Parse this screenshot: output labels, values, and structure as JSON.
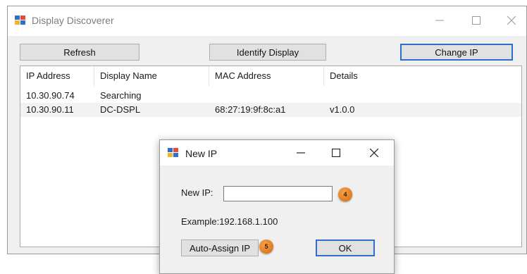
{
  "window": {
    "title": "Display Discoverer"
  },
  "toolbar": {
    "refresh_label": "Refresh",
    "identify_label": "Identify Display",
    "change_ip_label": "Change IP"
  },
  "list": {
    "columns": [
      "IP Address",
      "Display Name",
      "MAC Address",
      "Details"
    ],
    "rows": [
      {
        "ip": "10.30.90.74",
        "name": "Searching",
        "mac": "",
        "details": ""
      },
      {
        "ip": "10.30.90.11",
        "name": "DC-DSPL",
        "mac": "68:27:19:9f:8c:a1",
        "details": "v1.0.0"
      }
    ]
  },
  "dialog": {
    "title": "New IP",
    "new_ip_label": "New IP:",
    "new_ip_value": "",
    "example_text": "Example:192.168.1.100",
    "auto_assign_label": "Auto-Assign IP",
    "ok_label": "OK"
  },
  "callouts": {
    "step_4": "4",
    "step_5": "5"
  },
  "colors": {
    "accent_border": "#2f6fc9",
    "callout": "#e07a1f"
  }
}
